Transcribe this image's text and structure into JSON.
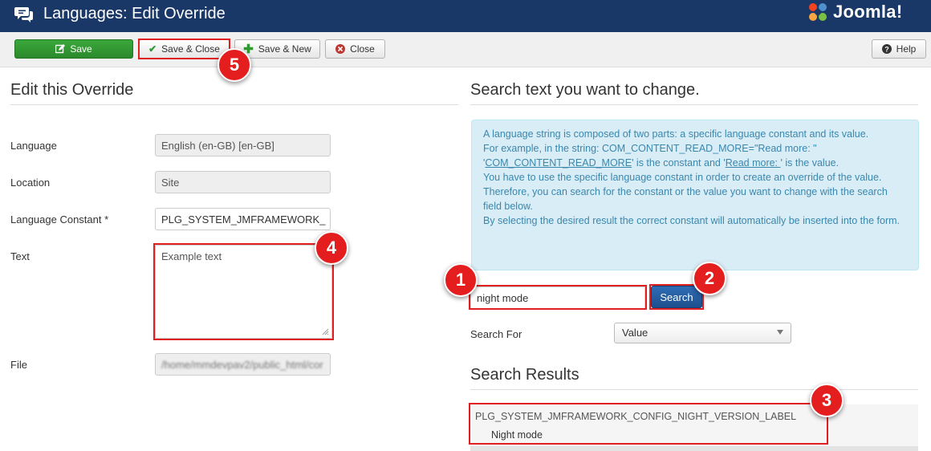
{
  "header": {
    "title": "Languages: Edit Override",
    "brand": "Joomla!"
  },
  "toolbar": {
    "save_label": "Save",
    "save_close_label": "Save & Close",
    "save_new_label": "Save & New",
    "close_label": "Close",
    "help_label": "Help"
  },
  "left": {
    "heading": "Edit this Override",
    "fields": {
      "language_label": "Language",
      "language_value": "English (en-GB) [en-GB]",
      "location_label": "Location",
      "location_value": "Site",
      "constant_label": "Language Constant *",
      "constant_value": "PLG_SYSTEM_JMFRAMEWORK_",
      "text_label": "Text",
      "text_value": "Example text",
      "file_label": "File",
      "file_value": "/home/mmdevpav2/public_html/cor"
    }
  },
  "right": {
    "heading": "Search text you want to change.",
    "info": {
      "line1": "A language string is composed of two parts: a specific language constant and its value.",
      "line2": "For example, in the string: COM_CONTENT_READ_MORE=\"Read more: \"",
      "line3_a": "'",
      "line3_const": "COM_CONTENT_READ_MORE",
      "line3_b": "' is the constant and '",
      "line3_val": "Read more: ",
      "line3_c": "' is the value.",
      "line4": "You have to use the specific language constant in order to create an override of the value.",
      "line5": "Therefore, you can search for the constant or the value you want to change with the search field below.",
      "line6": "By selecting the desired result the correct constant will automatically be inserted into the form."
    },
    "search_value": "night mode",
    "search_button": "Search",
    "search_for_label": "Search For",
    "search_for_value": "Value",
    "results_heading": "Search Results",
    "result_constant": "PLG_SYSTEM_JMFRAMEWORK_CONFIG_NIGHT_VERSION_LABEL",
    "result_value": "Night mode"
  },
  "callouts": [
    "1",
    "2",
    "3",
    "4",
    "5"
  ],
  "colors": {
    "header_bg": "#1a3867",
    "save_green": "#2f982f",
    "search_blue": "#1f5596",
    "highlight_red": "#e02020",
    "info_bg": "#d9edf7"
  }
}
